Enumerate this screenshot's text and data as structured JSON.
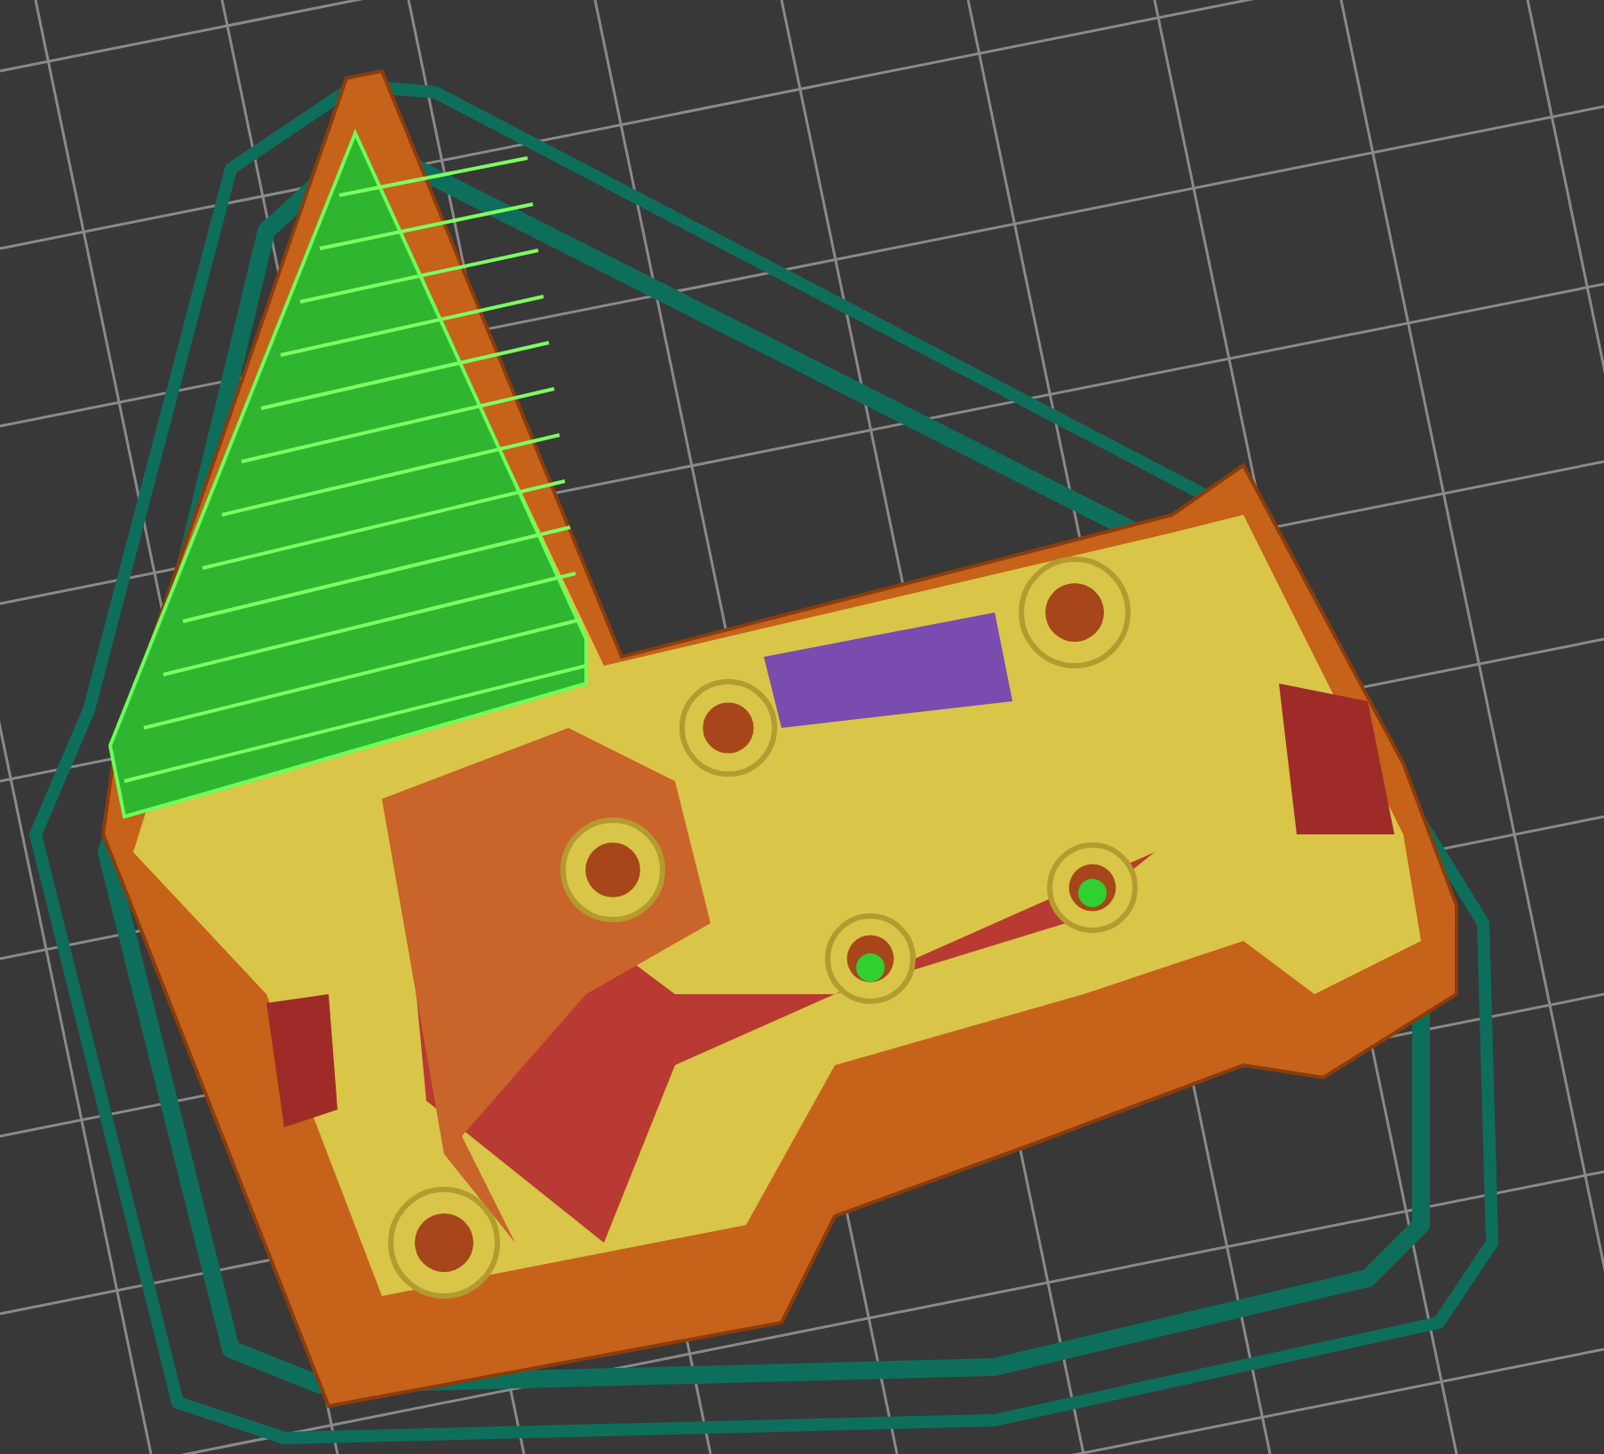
{
  "viewport": {
    "bed_grid": true,
    "skirt": true,
    "model": true
  }
}
